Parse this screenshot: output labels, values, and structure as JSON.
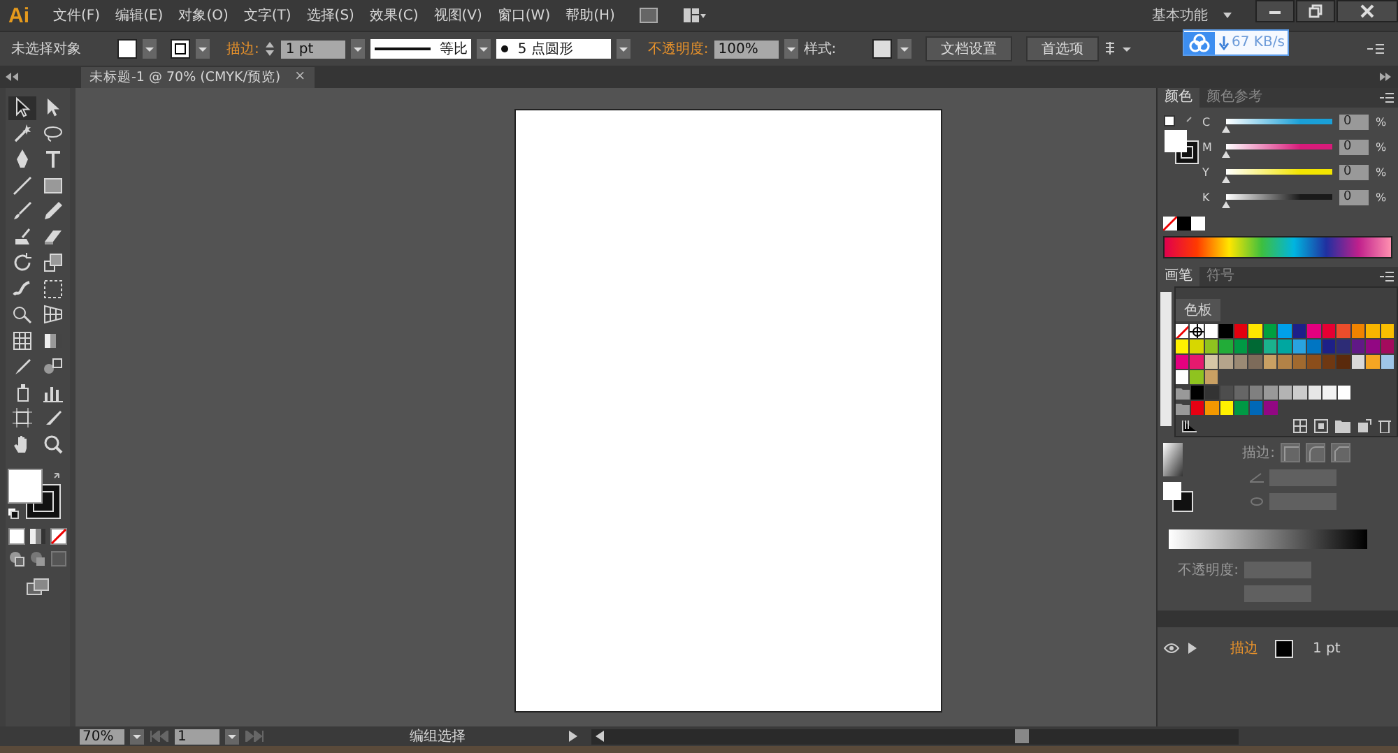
{
  "menu_bar": {
    "logo": "Ai",
    "menus": [
      "文件(F)",
      "编辑(E)",
      "对象(O)",
      "文字(T)",
      "选择(S)",
      "效果(C)",
      "视图(V)",
      "窗口(W)",
      "帮助(H)"
    ],
    "workspace": "基本功能"
  },
  "network_widget": {
    "speed": "67 KB/s"
  },
  "control_bar": {
    "selection": "未选择对象",
    "stroke_label": "描边:",
    "stroke_weight": "1 pt",
    "stroke_profile": "等比",
    "brush": "5 点圆形",
    "opacity_label": "不透明度:",
    "opacity": "100%",
    "style_label": "样式:",
    "buttons": [
      "文档设置",
      "首选项"
    ]
  },
  "document_tab": {
    "title": "未标题-1 @ 70% (CMYK/预览)",
    "close": "×"
  },
  "tools": [
    {
      "kind": "selection",
      "selected": true
    },
    {
      "kind": "direct-selection",
      "selected": false
    },
    {
      "kind": "magic-wand",
      "selected": false
    },
    {
      "kind": "lasso",
      "selected": false
    },
    {
      "kind": "pen",
      "selected": false
    },
    {
      "kind": "type",
      "selected": false
    },
    {
      "kind": "line",
      "selected": false
    },
    {
      "kind": "rectangle",
      "selected": false
    },
    {
      "kind": "paintbrush",
      "selected": false
    },
    {
      "kind": "pencil",
      "selected": false
    },
    {
      "kind": "blob-brush",
      "selected": false
    },
    {
      "kind": "eraser",
      "selected": false
    },
    {
      "kind": "rotate",
      "selected": false
    },
    {
      "kind": "scale",
      "selected": false
    },
    {
      "kind": "warp",
      "selected": false
    },
    {
      "kind": "free-transform",
      "selected": false
    },
    {
      "kind": "shape-builder",
      "selected": false
    },
    {
      "kind": "perspective-grid",
      "selected": false
    },
    {
      "kind": "mesh",
      "selected": false
    },
    {
      "kind": "gradient",
      "selected": false
    },
    {
      "kind": "eyedropper",
      "selected": false
    },
    {
      "kind": "blend",
      "selected": false
    },
    {
      "kind": "symbol-sprayer",
      "selected": false
    },
    {
      "kind": "column-graph",
      "selected": false
    },
    {
      "kind": "artboard",
      "selected": false
    },
    {
      "kind": "slice",
      "selected": false
    },
    {
      "kind": "hand",
      "selected": false
    },
    {
      "kind": "zoom",
      "selected": false
    }
  ],
  "color_panel": {
    "tabs": [
      {
        "label": "颜色",
        "selected": true
      },
      {
        "label": "颜色参考",
        "selected": false
      }
    ],
    "channels": [
      {
        "label": "C",
        "level": 0,
        "value": "0",
        "unit": "%",
        "color": "#1aa0d8"
      },
      {
        "label": "M",
        "level": 0,
        "value": "0",
        "unit": "%",
        "color": "#d81b7a"
      },
      {
        "label": "Y",
        "level": 0,
        "value": "0",
        "unit": "%",
        "color": "#f2e500"
      },
      {
        "label": "K",
        "level": 0,
        "value": "0",
        "unit": "%",
        "color": "#1a1a1a"
      }
    ]
  },
  "brush_panel": {
    "tabs": [
      {
        "label": "画笔",
        "selected": true
      },
      {
        "label": "符号",
        "selected": false
      }
    ]
  },
  "swatches_panel": {
    "title": "色板",
    "rows": [
      {
        "group": false,
        "swatches": [
          {
            "kind": "none"
          },
          {
            "kind": "registration"
          },
          {
            "kind": "color",
            "color": "#ffffff"
          },
          {
            "kind": "color",
            "color": "#000000"
          },
          {
            "kind": "color",
            "color": "#e3000f"
          },
          {
            "kind": "color",
            "color": "#ffe600"
          },
          {
            "kind": "color",
            "color": "#00a040"
          },
          {
            "kind": "color",
            "color": "#00a0e9"
          },
          {
            "kind": "color",
            "color": "#1d2088"
          },
          {
            "kind": "color",
            "color": "#e4007f"
          },
          {
            "kind": "color",
            "color": "#e60033"
          },
          {
            "kind": "color",
            "color": "#eb4d2b"
          },
          {
            "kind": "color",
            "color": "#f08300"
          },
          {
            "kind": "color",
            "color": "#f8b500"
          },
          {
            "kind": "color",
            "color": "#fabe00"
          }
        ]
      },
      {
        "group": false,
        "swatches": [
          {
            "kind": "color",
            "color": "#fff100"
          },
          {
            "kind": "color",
            "color": "#d7d700"
          },
          {
            "kind": "color",
            "color": "#8fc31f"
          },
          {
            "kind": "color",
            "color": "#22ac38"
          },
          {
            "kind": "color",
            "color": "#009944"
          },
          {
            "kind": "color",
            "color": "#006934"
          },
          {
            "kind": "color",
            "color": "#1bb28d"
          },
          {
            "kind": "color",
            "color": "#00a7a0"
          },
          {
            "kind": "color",
            "color": "#29a3e0"
          },
          {
            "kind": "color",
            "color": "#0075c2"
          },
          {
            "kind": "color",
            "color": "#1d2088"
          },
          {
            "kind": "color",
            "color": "#2d2c76"
          },
          {
            "kind": "color",
            "color": "#601986"
          },
          {
            "kind": "color",
            "color": "#920783"
          },
          {
            "kind": "color",
            "color": "#a40b5d"
          }
        ]
      },
      {
        "group": false,
        "swatches": [
          {
            "kind": "color",
            "color": "#e4007f"
          },
          {
            "kind": "color",
            "color": "#e5196e"
          },
          {
            "kind": "color",
            "color": "#d6c6a6"
          },
          {
            "kind": "color",
            "color": "#b5a48b"
          },
          {
            "kind": "color",
            "color": "#9b8a74"
          },
          {
            "kind": "color",
            "color": "#7d6b5a"
          },
          {
            "kind": "color",
            "color": "#c9a063"
          },
          {
            "kind": "color",
            "color": "#b28247"
          },
          {
            "kind": "color",
            "color": "#a16a2f"
          },
          {
            "kind": "color",
            "color": "#8b4e1b"
          },
          {
            "kind": "color",
            "color": "#6f3812"
          },
          {
            "kind": "color",
            "color": "#5a2a0c"
          },
          {
            "kind": "color",
            "color": "#d9d9d9"
          },
          {
            "kind": "color",
            "color": "#f5a623"
          },
          {
            "kind": "color",
            "color": "#9fc6e8"
          }
        ]
      },
      {
        "group": false,
        "swatches": [
          {
            "kind": "color",
            "color": "#ffffff"
          },
          {
            "kind": "color",
            "color": "#8fc31f"
          },
          {
            "kind": "color",
            "color": "#c9a063"
          }
        ]
      },
      {
        "group": true,
        "swatches": [
          {
            "kind": "color",
            "color": "#000000"
          },
          {
            "kind": "color",
            "color": "#333333"
          },
          {
            "kind": "color",
            "color": "#4d4d4d"
          },
          {
            "kind": "color",
            "color": "#666666"
          },
          {
            "kind": "color",
            "color": "#808080"
          },
          {
            "kind": "color",
            "color": "#999999"
          },
          {
            "kind": "color",
            "color": "#b3b3b3"
          },
          {
            "kind": "color",
            "color": "#cccccc"
          },
          {
            "kind": "color",
            "color": "#e6e6e6"
          },
          {
            "kind": "color",
            "color": "#f2f2f2"
          },
          {
            "kind": "color",
            "color": "#ffffff"
          }
        ]
      },
      {
        "group": true,
        "swatches": [
          {
            "kind": "color",
            "color": "#e60012"
          },
          {
            "kind": "color",
            "color": "#f39800"
          },
          {
            "kind": "color",
            "color": "#fff100"
          },
          {
            "kind": "color",
            "color": "#009944"
          },
          {
            "kind": "color",
            "color": "#0068b7"
          },
          {
            "kind": "color",
            "color": "#920783"
          }
        ]
      }
    ]
  },
  "stroke_panel": {
    "label": "描边:",
    "opacity_label": "不透明度:"
  },
  "appearance": {
    "rows": [
      {
        "label": "描边",
        "value": "1 pt"
      }
    ]
  },
  "status_bar": {
    "zoom": "70%",
    "artboard": "1",
    "tool": "编组选择"
  }
}
